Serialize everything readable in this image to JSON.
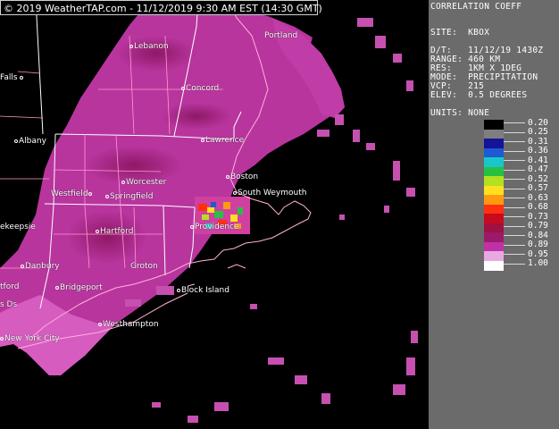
{
  "map": {
    "copyright": "© 2019 WeatherTAP.com - 11/12/2019  9:30 AM EST (14:30 GMT)",
    "cities": [
      {
        "label": "Portland",
        "dot": false
      },
      {
        "label": "Lebanon",
        "dot": true
      },
      {
        "label": "Falls",
        "dot": true
      },
      {
        "label": "Concord",
        "dot": true
      },
      {
        "label": "Albany",
        "dot": true
      },
      {
        "label": "Lawrence",
        "dot": true
      },
      {
        "label": "Worcester",
        "dot": true
      },
      {
        "label": "Boston",
        "dot": true
      },
      {
        "label": "Westfield",
        "dot": true
      },
      {
        "label": "Springfield",
        "dot": true
      },
      {
        "label": "South Weymouth",
        "dot": true
      },
      {
        "label": "ekeepsie",
        "dot": true
      },
      {
        "label": "Hartford",
        "dot": true
      },
      {
        "label": "Providence",
        "dot": true
      },
      {
        "label": "Danbury",
        "dot": true
      },
      {
        "label": "Groton",
        "dot": false
      },
      {
        "label": "Bridgeport",
        "dot": true
      },
      {
        "label": "Block Island",
        "dot": true
      },
      {
        "label": "tford",
        "dot": false
      },
      {
        "label": "s Ds",
        "dot": false
      },
      {
        "label": "Westhampton",
        "dot": true
      },
      {
        "label": "New York City",
        "dot": true
      }
    ]
  },
  "panel": {
    "product": "CORRELATION COEFF",
    "site_row": "SITE:  KBOX",
    "info_rows": [
      "D/T:   11/12/19 1430Z",
      "RANGE: 460 KM",
      "RES:   1KM X 1DEG",
      "MODE:  PRECIPITATION",
      "VCP:   215",
      "ELEV:  0.5 DEGREES"
    ],
    "units_row": "UNITS: NONE",
    "scale": [
      {
        "value": "0.20",
        "color": "#000000"
      },
      {
        "value": "0.25",
        "color": "#7e7e7e"
      },
      {
        "value": "0.31",
        "color": "#141498"
      },
      {
        "value": "0.36",
        "color": "#1e5ad2"
      },
      {
        "value": "0.41",
        "color": "#18c8c8"
      },
      {
        "value": "0.47",
        "color": "#28c040"
      },
      {
        "value": "0.52",
        "color": "#b4e020"
      },
      {
        "value": "0.57",
        "color": "#ffe020"
      },
      {
        "value": "0.63",
        "color": "#ff9a10"
      },
      {
        "value": "0.68",
        "color": "#ff3010"
      },
      {
        "value": "0.73",
        "color": "#c80a20"
      },
      {
        "value": "0.79",
        "color": "#a01040"
      },
      {
        "value": "0.84",
        "color": "#9c1a6a"
      },
      {
        "value": "0.89",
        "color": "#c030a8"
      },
      {
        "value": "0.95",
        "color": "#e8a8e0"
      },
      {
        "value": "1.00",
        "color": "#ffffff"
      }
    ]
  }
}
